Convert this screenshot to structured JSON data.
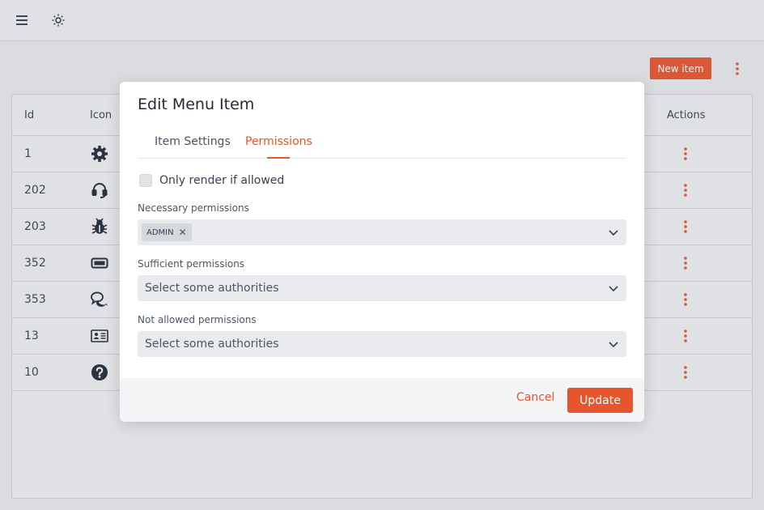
{
  "topbar": {
    "menu_icon": "hamburger-menu-icon",
    "theme_icon": "sun-icon"
  },
  "page": {
    "new_item_label": "New item",
    "more_icon": "kebab-icon"
  },
  "table": {
    "headers": {
      "id": "Id",
      "icon": "Icon",
      "actions": "Actions"
    },
    "rows": [
      {
        "id": "1",
        "icon": "gear-icon"
      },
      {
        "id": "202",
        "icon": "headset-icon"
      },
      {
        "id": "203",
        "icon": "bug-icon"
      },
      {
        "id": "352",
        "icon": "battery-icon"
      },
      {
        "id": "353",
        "icon": "comments-icon"
      },
      {
        "id": "13",
        "icon": "id-card-icon"
      },
      {
        "id": "10",
        "icon": "question-circle-icon"
      }
    ]
  },
  "modal": {
    "title": "Edit Menu Item",
    "tabs": [
      {
        "label": "Item Settings",
        "active": false
      },
      {
        "label": "Permissions",
        "active": true
      }
    ],
    "only_render_label": "Only render if allowed",
    "necessary": {
      "label": "Necessary permissions",
      "tags": [
        "ADMIN"
      ]
    },
    "sufficient": {
      "label": "Sufficient permissions",
      "placeholder": "Select some authorities"
    },
    "not_allowed": {
      "label": "Not allowed permissions",
      "placeholder": "Select some authorities"
    },
    "cancel_label": "Cancel",
    "update_label": "Update"
  },
  "colors": {
    "accent": "#e8542b",
    "background": "#e8eaed"
  }
}
